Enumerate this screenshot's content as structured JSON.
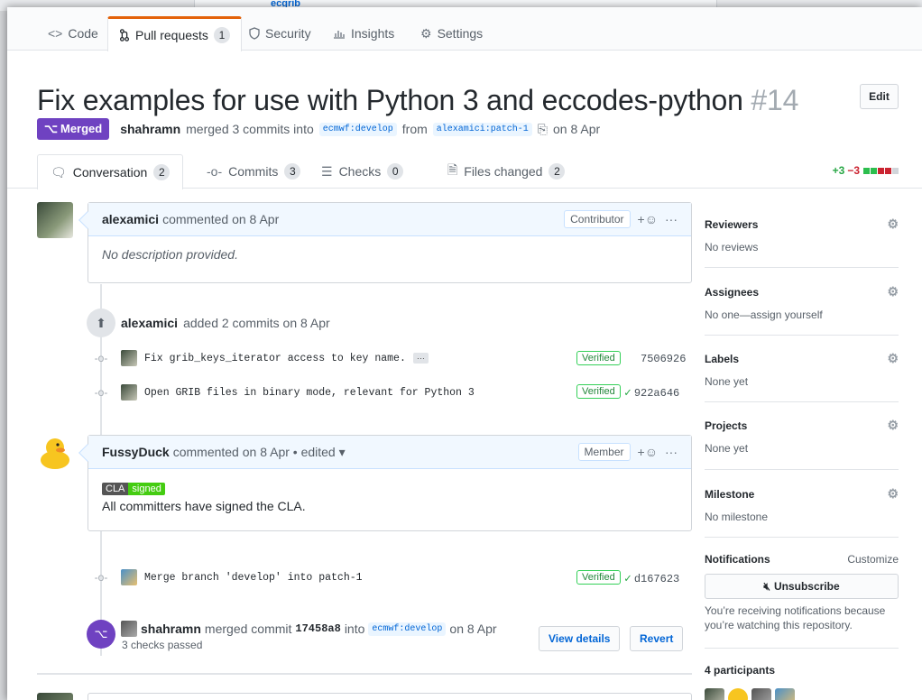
{
  "background": {
    "repo_link": "ecgrib"
  },
  "nav": {
    "tabs": [
      {
        "label": "Code",
        "icon": "code-icon"
      },
      {
        "label": "Pull requests",
        "count": "1",
        "icon": "pull-request-icon",
        "selected": true
      },
      {
        "label": "Security",
        "icon": "shield-icon"
      },
      {
        "label": "Insights",
        "icon": "graph-icon"
      },
      {
        "label": "Settings",
        "icon": "gear-icon"
      }
    ]
  },
  "pr": {
    "title": "Fix examples for use with Python 3 and eccodes-python",
    "number": "#14",
    "edit_label": "Edit",
    "state": "Merged",
    "author": "shahramn",
    "merge_text": "merged 3 commits into",
    "base_branch": "ecmwf:develop",
    "from_text": "from",
    "head_branch": "alexamici:patch-1",
    "date_text": "on 8 Apr"
  },
  "tabs": [
    {
      "label": "Conversation",
      "count": "2"
    },
    {
      "label": "Commits",
      "count": "3"
    },
    {
      "label": "Checks",
      "count": "0"
    },
    {
      "label": "Files changed",
      "count": "2"
    }
  ],
  "diffstat": {
    "additions": "+3",
    "deletions": "−3"
  },
  "comment1": {
    "author": "alexamici",
    "action": "commented on 8 Apr",
    "role": "Contributor",
    "body": "No description provided."
  },
  "commits_event": {
    "author": "alexamici",
    "text": "added 2 commits on 8 Apr",
    "commits": [
      {
        "message": "Fix grib_keys_iterator access to key name.",
        "verified": "Verified",
        "sha": "7506926"
      },
      {
        "message": "Open GRIB files in binary mode, relevant for Python 3",
        "verified": "Verified",
        "sha": "922a646"
      }
    ]
  },
  "comment2": {
    "author": "FussyDuck",
    "action": "commented on 8 Apr • edited ▾",
    "role": "Member",
    "badge_left": "CLA",
    "badge_right": "signed",
    "body": "All committers have signed the CLA."
  },
  "merge_commit": {
    "message": "Merge branch 'develop' into patch-1",
    "verified": "Verified",
    "sha": "d167623"
  },
  "merge_event": {
    "author": "shahramn",
    "text": "merged commit",
    "sha": "17458a8",
    "into": "into",
    "branch": "ecmwf:develop",
    "date": "on 8 Apr",
    "checks": "3 checks passed",
    "details_label": "View details",
    "revert_label": "Revert"
  },
  "sidebar": {
    "reviewers": {
      "title": "Reviewers",
      "value": "No reviews"
    },
    "assignees": {
      "title": "Assignees",
      "value": "No one—assign yourself"
    },
    "labels": {
      "title": "Labels",
      "value": "None yet"
    },
    "projects": {
      "title": "Projects",
      "value": "None yet"
    },
    "milestone": {
      "title": "Milestone",
      "value": "No milestone"
    },
    "notifications": {
      "title": "Notifications",
      "customize": "Customize",
      "button": "Unsubscribe",
      "note": "You’re receiving notifications because you’re watching this repository."
    },
    "participants": "4 participants"
  }
}
